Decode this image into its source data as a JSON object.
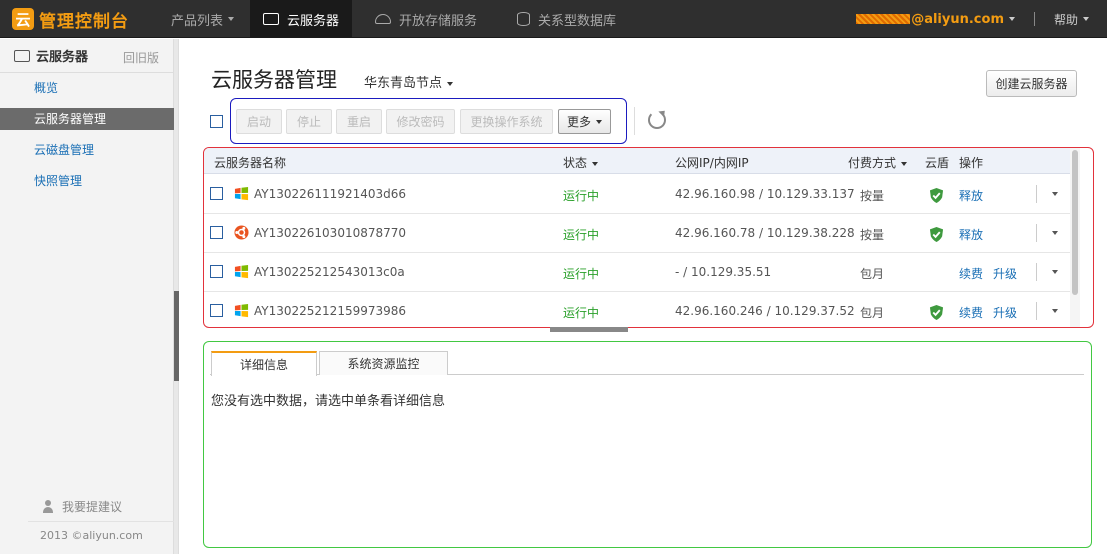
{
  "topbar": {
    "logo_text": "管理控制台",
    "nav": [
      {
        "label": "产品列表"
      },
      {
        "label": "云服务器"
      },
      {
        "label": "开放存储服务"
      },
      {
        "label": "关系型数据库"
      }
    ],
    "user_suffix": "@aliyun.com",
    "help": "帮助"
  },
  "sidebar": {
    "title": "云服务器",
    "back": "回旧版",
    "items": [
      {
        "label": "概览"
      },
      {
        "label": "云服务器管理"
      },
      {
        "label": "云磁盘管理"
      },
      {
        "label": "快照管理"
      }
    ],
    "feedback": "我要提建议",
    "copyright": "2013 ©aliyun.com"
  },
  "main": {
    "title": "云服务器管理",
    "region": "华东青岛节点",
    "create_button": "创建云服务器",
    "toolbar": {
      "start": "启动",
      "stop": "停止",
      "restart": "重启",
      "change_password": "修改密码",
      "change_os": "更换操作系统",
      "more": "更多"
    }
  },
  "table": {
    "columns": {
      "name": "云服务器名称",
      "status": "状态",
      "ip": "公网IP/内网IP",
      "billing": "付费方式",
      "shield": "云盾",
      "actions": "操作"
    },
    "rows": [
      {
        "name": "AY130226111921403d66",
        "status": "运行中",
        "ip": "42.96.160.98 / 10.129.33.137",
        "billing": "按量",
        "action1": "释放",
        "action2": "",
        "os": "windows"
      },
      {
        "name": "AY130226103010878770",
        "status": "运行中",
        "ip": "42.96.160.78 / 10.129.38.228",
        "billing": "按量",
        "action1": "释放",
        "action2": "",
        "os": "ubuntu"
      },
      {
        "name": "AY130225212543013c0a",
        "status": "运行中",
        "ip": "- / 10.129.35.51",
        "billing": "包月",
        "action1": "续费",
        "action2": "升级",
        "os": "windows"
      },
      {
        "name": "AY130225212159973986",
        "status": "运行中",
        "ip": "42.96.160.246 / 10.129.37.52",
        "billing": "包月",
        "action1": "续费",
        "action2": "升级",
        "os": "windows"
      }
    ]
  },
  "detail": {
    "tabs": [
      {
        "label": "详细信息"
      },
      {
        "label": "系统资源监控"
      }
    ],
    "empty_message": "您没有选中数据，请选中单条看详细信息"
  },
  "colors": {
    "accent": "#f39c12",
    "status_running": "#2aa02a",
    "link": "#1a6fb5"
  }
}
